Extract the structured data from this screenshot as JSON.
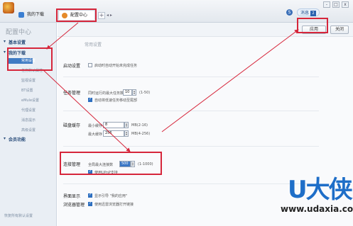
{
  "tabs": [
    {
      "label": "我的下载"
    },
    {
      "label": "配置中心"
    }
  ],
  "tab_scroll": "◂ ▸",
  "window_controls": [
    "-",
    "□",
    "x"
  ],
  "skin_icon": "S",
  "window_pill": {
    "label": "消息",
    "badge": "2"
  },
  "sidebar": {
    "title": "配置中心",
    "sections": [
      {
        "label": "基本设置"
      },
      {
        "label": "我的下载"
      },
      {
        "label": "会员功能"
      }
    ],
    "items": [
      {
        "label": "常用设置"
      },
      {
        "label": "任务默认属性"
      },
      {
        "label": "监视设置"
      },
      {
        "label": "BT设置"
      },
      {
        "label": "eMule设置"
      },
      {
        "label": "代理设置"
      },
      {
        "label": "消息提示"
      },
      {
        "label": "高级设置"
      }
    ],
    "footer": "恢复所有默认设置"
  },
  "header": {
    "apply_label": "应用",
    "close_label": "关闭"
  },
  "content": {
    "section_heading": "常用设置",
    "startup": {
      "title": "启动设置",
      "option": "启动时自动开始未完成任务",
      "checked": false
    },
    "task": {
      "title": "任务管理",
      "max_tasks_label": "同时运行的最大任务数",
      "max_tasks_value": "10",
      "max_tasks_range": "(1-50)",
      "auto_move_label": "自动将低速任务移动至尾部",
      "auto_move_checked": true
    },
    "disk": {
      "title": "磁盘缓存",
      "min_label": "最小缓存",
      "min_value": "8",
      "min_range": "MB(2-16)",
      "max_label": "最大缓存",
      "max_value": "256",
      "max_range": "MB(4-256)"
    },
    "connection": {
      "title": "连接管理",
      "max_conn_label": "全局最大连接数",
      "max_conn_value": "500",
      "max_conn_range": "(1-1000)",
      "upnp_label": "使用UPnP支持",
      "upnp_checked": true
    },
    "interface": {
      "title": "界面显示",
      "option": "显示引导 \"我的应用\"",
      "checked": true
    },
    "browser": {
      "title": "浏览器管理",
      "option": "使用迅雷浏览器打开链接",
      "checked": true
    }
  },
  "watermark": {
    "logo": "U大侠",
    "url": "www.udaxia.com"
  },
  "colors": {
    "annotation_red": "#d6263b",
    "accent_blue": "#3f7bc4",
    "watermark_blue": "#1e6ec8"
  }
}
